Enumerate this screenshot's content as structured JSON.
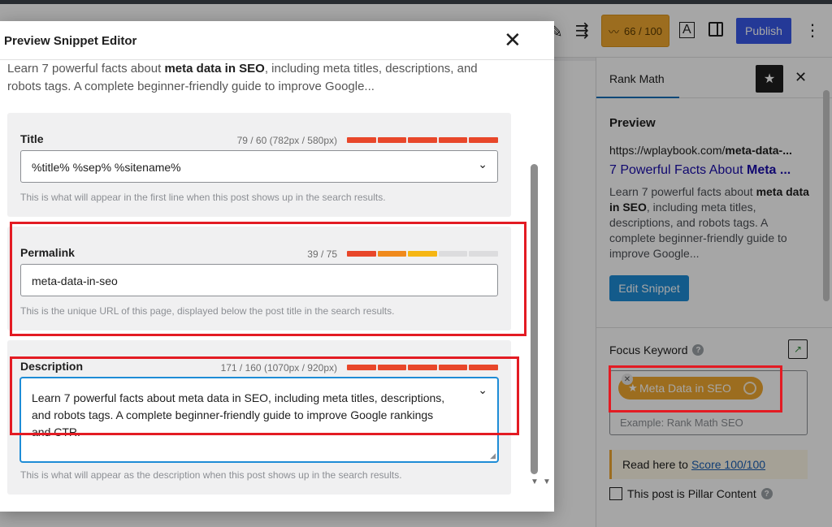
{
  "topbar": {
    "score_label": "66 / 100",
    "publish_label": "Publish",
    "more_label": "⋮"
  },
  "sidebar": {
    "header_title": "Rank Math",
    "preview_title": "Preview",
    "url_prefix": "https://wplaybook.com/",
    "url_bold": "meta-data-...",
    "link_prefix": "7 Powerful Facts About ",
    "link_bold": "Meta ...",
    "desc_pre": "Learn 7 powerful facts about ",
    "desc_bold": "meta data in SEO",
    "desc_post": ", including meta titles, descriptions, and robots tags. A complete beginner-friendly guide to improve Google...",
    "edit_snippet_label": "Edit Snippet",
    "focus_keyword_label": "Focus Keyword",
    "keyword_chip": "Meta Data in SEO",
    "keyword_placeholder": "Example: Rank Math SEO",
    "readhere_text": "Read here to",
    "readhere_link": "Score 100/100",
    "pillar_label": "This post is Pillar Content"
  },
  "modal": {
    "title": "Preview Snippet Editor",
    "intro_pre": "Learn 7 powerful facts about ",
    "intro_bold": "meta data in SEO",
    "intro_post": ", including meta titles, descriptions, and robots tags. A complete beginner-friendly guide to improve Google...",
    "title_section": {
      "label": "Title",
      "count": "79 / 60 (782px / 580px)",
      "value": "%title% %sep% %sitename%",
      "help": "This is what will appear in the first line when this post shows up in the search results.",
      "meter": [
        "#e8472a",
        "#e8472a",
        "#e8472a",
        "#e8472a",
        "#e8472a"
      ]
    },
    "permalink_section": {
      "label": "Permalink",
      "count": "39 / 75",
      "value": "meta-data-in-seo",
      "help": "This is the unique URL of this page, displayed below the post title in the search results.",
      "meter": [
        "#e8472a",
        "#f08a1c",
        "#f6b614",
        "#dcdcde",
        "#dcdcde"
      ]
    },
    "description_section": {
      "label": "Description",
      "count": "171 / 160 (1070px / 920px)",
      "value": "Learn 7 powerful facts about meta data in SEO, including meta titles, descriptions, and robots tags. A complete beginner-friendly guide to improve Google rankings and CTR.",
      "help": "This is what will appear as the description when this post shows up in the search results.",
      "meter": [
        "#e8472a",
        "#e8472a",
        "#e8472a",
        "#e8472a",
        "#e8472a"
      ]
    }
  },
  "colors": {
    "highlight_red": "#e31b23",
    "rank_orange": "#f0a830",
    "publish_blue": "#3858e9",
    "focus_blue": "#1e8cd6"
  }
}
